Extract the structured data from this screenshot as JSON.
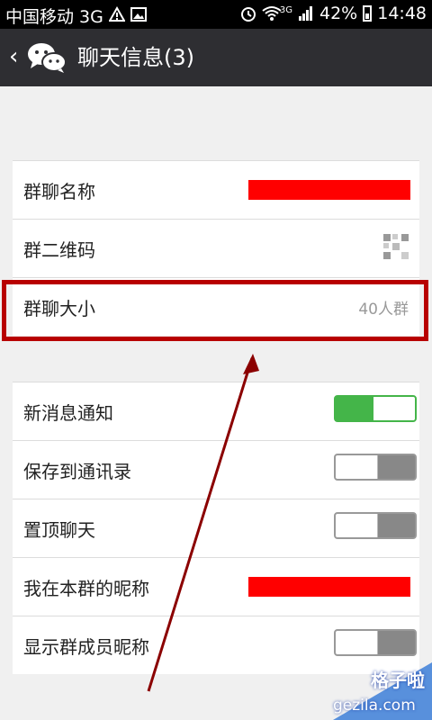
{
  "status_bar": {
    "carrier": "中国移动 3G",
    "network": "3G",
    "battery": "42%",
    "time": "14:48"
  },
  "header": {
    "back_icon": "chevron-left-icon",
    "logo_icon": "wechat-icon",
    "title": "聊天信息(3)"
  },
  "group_info": {
    "rows": [
      {
        "label": "群聊名称",
        "value_type": "redacted"
      },
      {
        "label": "群二维码",
        "value_type": "qr-code-icon"
      },
      {
        "label": "群聊大小",
        "value": "40人群"
      }
    ]
  },
  "settings": {
    "rows": [
      {
        "label": "新消息通知",
        "toggle": true
      },
      {
        "label": "保存到通讯录",
        "toggle": false
      },
      {
        "label": "置顶聊天",
        "toggle": false
      },
      {
        "label": "我在本群的昵称",
        "value_type": "redacted"
      },
      {
        "label": "显示群成员昵称",
        "toggle": false
      }
    ]
  },
  "annotation": {
    "highlight_color": "#b80000",
    "arrow_color": "#8b0000"
  },
  "watermark": {
    "title": "格子啦",
    "url": "gezila.com"
  },
  "colors": {
    "header_bg": "#2e2e32",
    "toggle_on": "#44b549",
    "redaction": "#ff0000"
  }
}
